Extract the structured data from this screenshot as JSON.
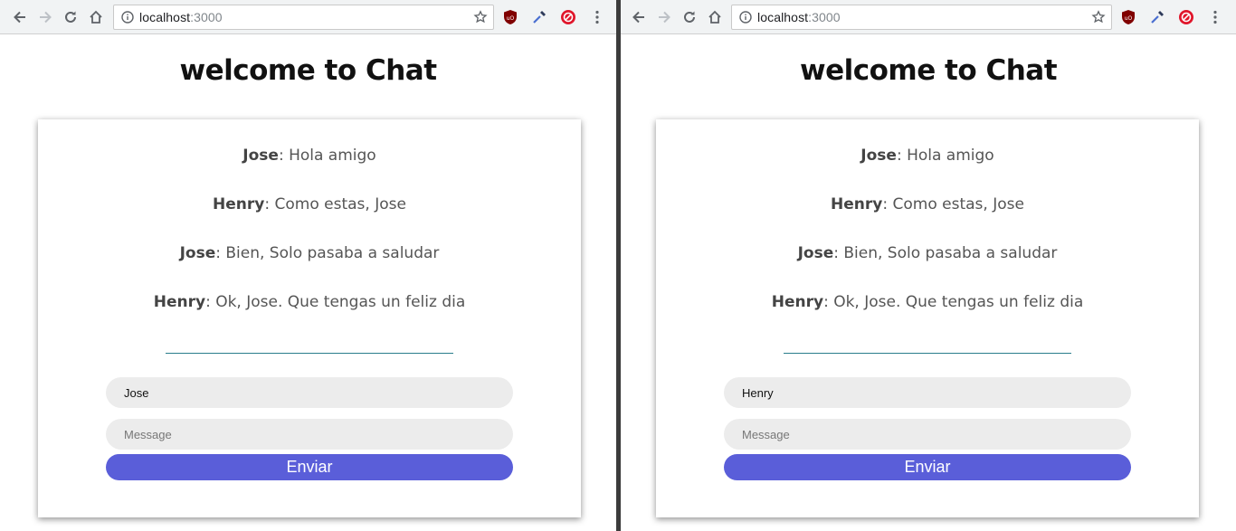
{
  "windows": [
    {
      "address": {
        "host": "localhost",
        "port": ":3000"
      },
      "title": "welcome to Chat",
      "messages": [
        {
          "author": "Jose",
          "text": ": Hola amigo"
        },
        {
          "author": "Henry",
          "text": ": Como estas, Jose"
        },
        {
          "author": "Jose",
          "text": ": Bien, Solo pasaba a saludar"
        },
        {
          "author": "Henry",
          "text": ": Ok, Jose. Que tengas un feliz dia"
        }
      ],
      "handle_value": "Jose",
      "message_placeholder": "Message",
      "send_label": "Enviar"
    },
    {
      "address": {
        "host": "localhost",
        "port": ":3000"
      },
      "title": "welcome to Chat",
      "messages": [
        {
          "author": "Jose",
          "text": ": Hola amigo"
        },
        {
          "author": "Henry",
          "text": ": Como estas, Jose"
        },
        {
          "author": "Jose",
          "text": ": Bien, Solo pasaba a saludar"
        },
        {
          "author": "Henry",
          "text": ": Ok, Jose. Que tengas un feliz dia"
        }
      ],
      "handle_value": "Henry",
      "message_placeholder": "Message",
      "send_label": "Enviar"
    }
  ],
  "icons": [
    "back-icon",
    "forward-icon",
    "reload-icon",
    "home-icon",
    "info-icon",
    "star-icon",
    "ublock-icon",
    "eyedropper-icon",
    "adblock-icon",
    "menu-icon"
  ],
  "colors": {
    "accent": "#5a5ed9",
    "feedback_line": "#2a7d8c",
    "input_bg": "#ececec"
  }
}
